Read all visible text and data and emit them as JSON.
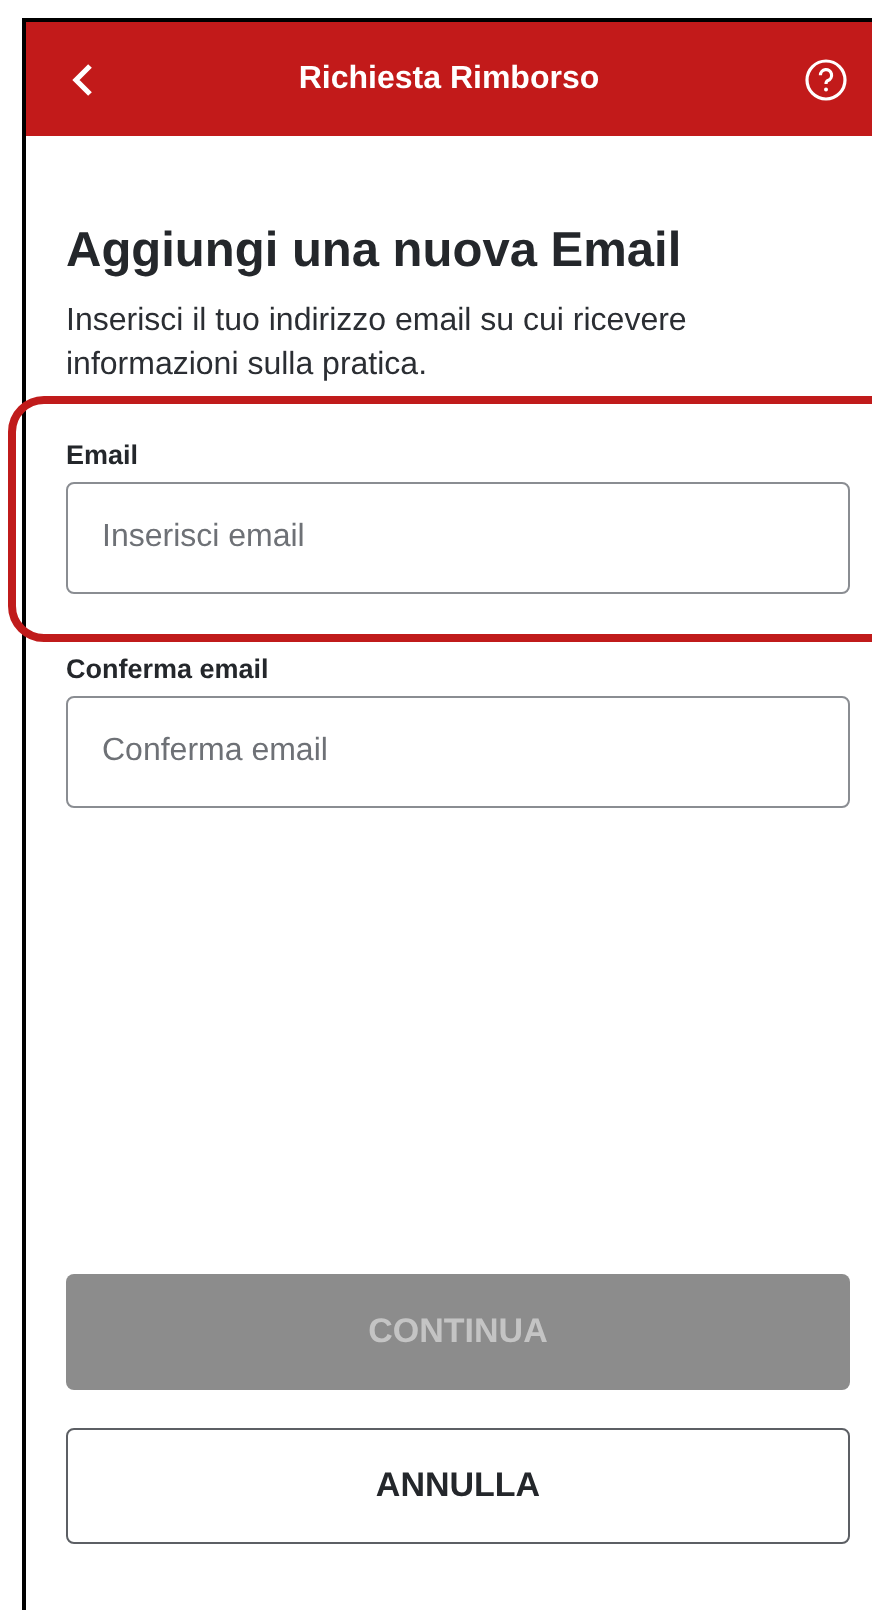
{
  "header": {
    "title": "Richiesta Rimborso"
  },
  "heading": "Aggiungi una nuova Email",
  "description": "Inserisci il tuo indirizzo email su cui ricevere informazioni sulla pratica.",
  "fields": [
    {
      "label": "Email",
      "placeholder": "Inserisci email",
      "highlighted": true
    },
    {
      "label": "Conferma email",
      "placeholder": "Conferma email"
    }
  ],
  "buttons": [
    {
      "label": "CONTINUA",
      "kind": "primary",
      "disabled": true
    },
    {
      "label": "ANNULLA",
      "kind": "secondary",
      "disabled": false
    }
  ]
}
